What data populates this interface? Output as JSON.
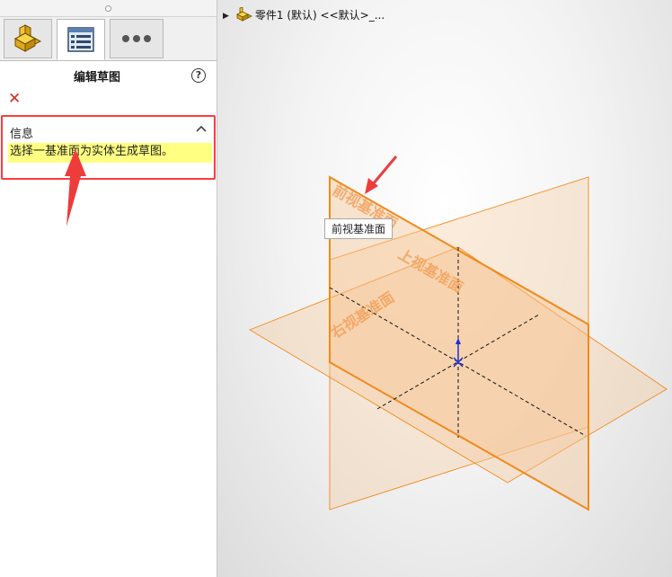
{
  "panel": {
    "tabs": [
      {
        "name": "featuremanager",
        "icon": "part-feature-icon"
      },
      {
        "name": "propertymanager",
        "icon": "property-list-icon",
        "active": true
      },
      {
        "name": "more",
        "icon": "more-dots-icon"
      }
    ],
    "title": "编辑草图",
    "help_icon_text": "?",
    "close_icon_text": "✕",
    "info": {
      "header": "信息",
      "message": "选择一基准面为实体生成草图。"
    }
  },
  "graphics": {
    "tree_title": "零件1 (默认) <<默认>_...",
    "planes": {
      "front": "前视基准面",
      "top": "上视基准面",
      "right": "右视基准面"
    },
    "tooltip": "前视基准面"
  },
  "colors": {
    "plane_orange": "#f08a1c",
    "plane_fill": "#f6c89a",
    "annotation_red": "#ee3b3b",
    "info_highlight": "#ffff82",
    "origin_blue": "#1b2fd6"
  }
}
